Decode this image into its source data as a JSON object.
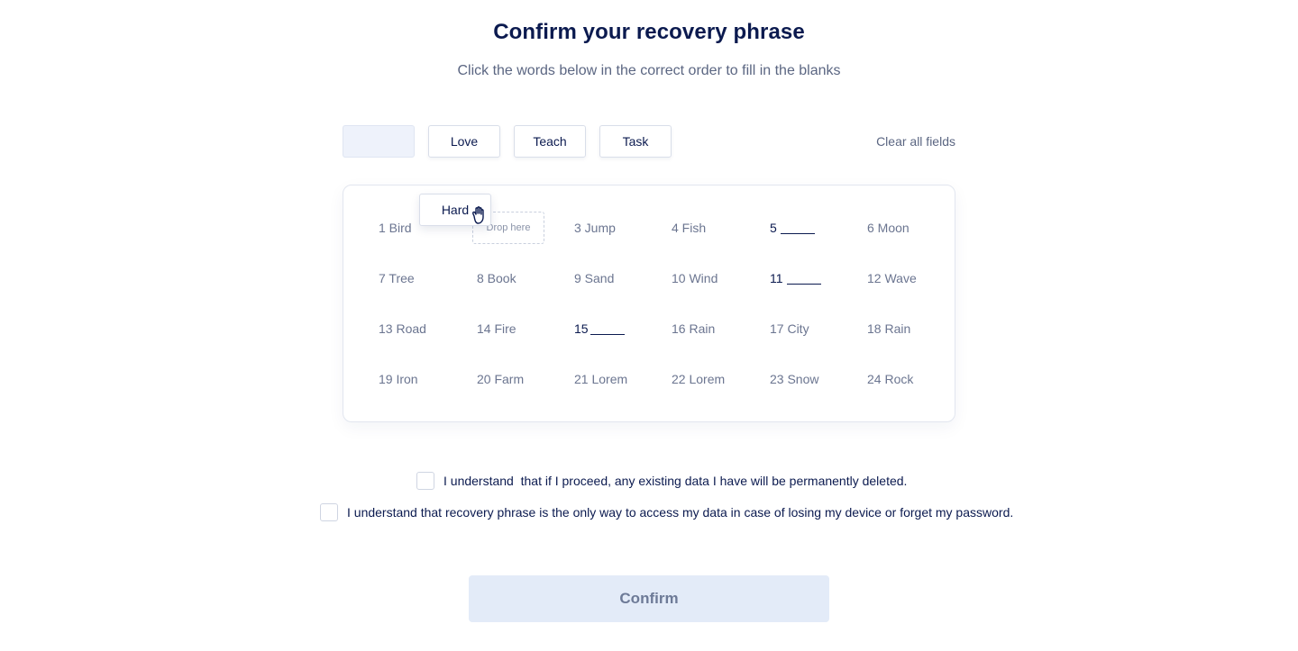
{
  "header": {
    "title": "Confirm your recovery phrase",
    "subtitle": "Click the words below in the correct order to fill in the blanks"
  },
  "chips": [
    {
      "label": "",
      "state": "empty"
    },
    {
      "label": "Love"
    },
    {
      "label": "Teach"
    },
    {
      "label": "Task"
    }
  ],
  "clear_label": "Clear all fields",
  "grid": {
    "cells": [
      "1 Bird",
      "",
      "3 Jump",
      "4 Fish",
      "5",
      "6 Moon",
      "7 Tree",
      "8 Book",
      "9 Sand",
      "10 Wind",
      "11",
      "12 Wave",
      "13 Road",
      "14 Fire",
      "15",
      "16 Rain",
      "17 City",
      "18 Rain",
      "19 Iron",
      "20 Farm",
      "21 Lorem",
      "22 Lorem",
      "23 Snow",
      "24 Rock"
    ],
    "drop_zone_label": "Drop here",
    "dragging_word": "Hard"
  },
  "checks": [
    "I understand  that if I proceed, any existing data I have will be permanently deleted.",
    "I understand that recovery phrase is the only way to access my data in case of losing my device or forget my password."
  ],
  "confirm_label": "Confirm",
  "colors": {
    "heading": "#0b1a4f",
    "muted": "#5b6682",
    "button_bg": "#e3ebf8",
    "placeholder_bg": "#eef2fb"
  },
  "icons": {
    "drag_cursor": "grab-hand-icon"
  }
}
